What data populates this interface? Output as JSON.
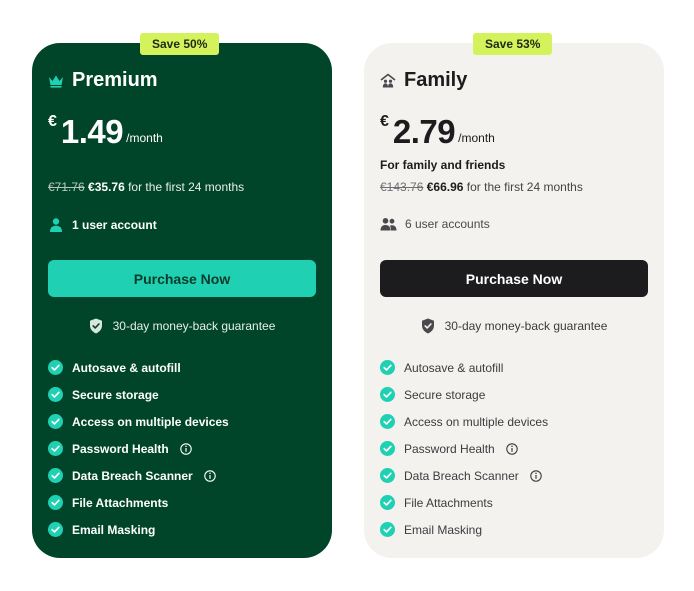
{
  "colors": {
    "premium_bg": "#00452a",
    "family_bg": "#f3f2ee",
    "badge": "#d4f25c",
    "accent_teal": "#1fd1b2",
    "family_button": "#1c1c1e"
  },
  "plans": [
    {
      "badge": "Save 50%",
      "icon": "crown-icon",
      "name": "Premium",
      "currency": "€",
      "price": "1.49",
      "period": "/month",
      "tagline": "",
      "original_price": "€71.76",
      "discounted_price": "€35.76",
      "duration": "for the first 24 months",
      "accounts_icon": "user-icon",
      "accounts": "1 user account",
      "cta": "Purchase Now",
      "guarantee": "30-day money-back guarantee",
      "features": [
        {
          "label": "Autosave & autofill"
        },
        {
          "label": "Secure storage"
        },
        {
          "label": "Access on multiple devices"
        },
        {
          "label": "Password Health",
          "info": true
        },
        {
          "label": "Data Breach Scanner",
          "info": true
        },
        {
          "label": "File Attachments"
        },
        {
          "label": "Email Masking"
        }
      ]
    },
    {
      "badge": "Save 53%",
      "icon": "family-house-icon",
      "name": "Family",
      "currency": "€",
      "price": "2.79",
      "period": "/month",
      "tagline": "For family and friends",
      "original_price": "€143.76",
      "discounted_price": "€66.96",
      "duration": "for the first 24 months",
      "accounts_icon": "users-icon",
      "accounts": "6 user accounts",
      "cta": "Purchase Now",
      "guarantee": "30-day money-back guarantee",
      "features": [
        {
          "label": "Autosave & autofill"
        },
        {
          "label": "Secure storage"
        },
        {
          "label": "Access on multiple devices"
        },
        {
          "label": "Password Health",
          "info": true
        },
        {
          "label": "Data Breach Scanner",
          "info": true
        },
        {
          "label": "File Attachments"
        },
        {
          "label": "Email Masking"
        }
      ]
    }
  ]
}
